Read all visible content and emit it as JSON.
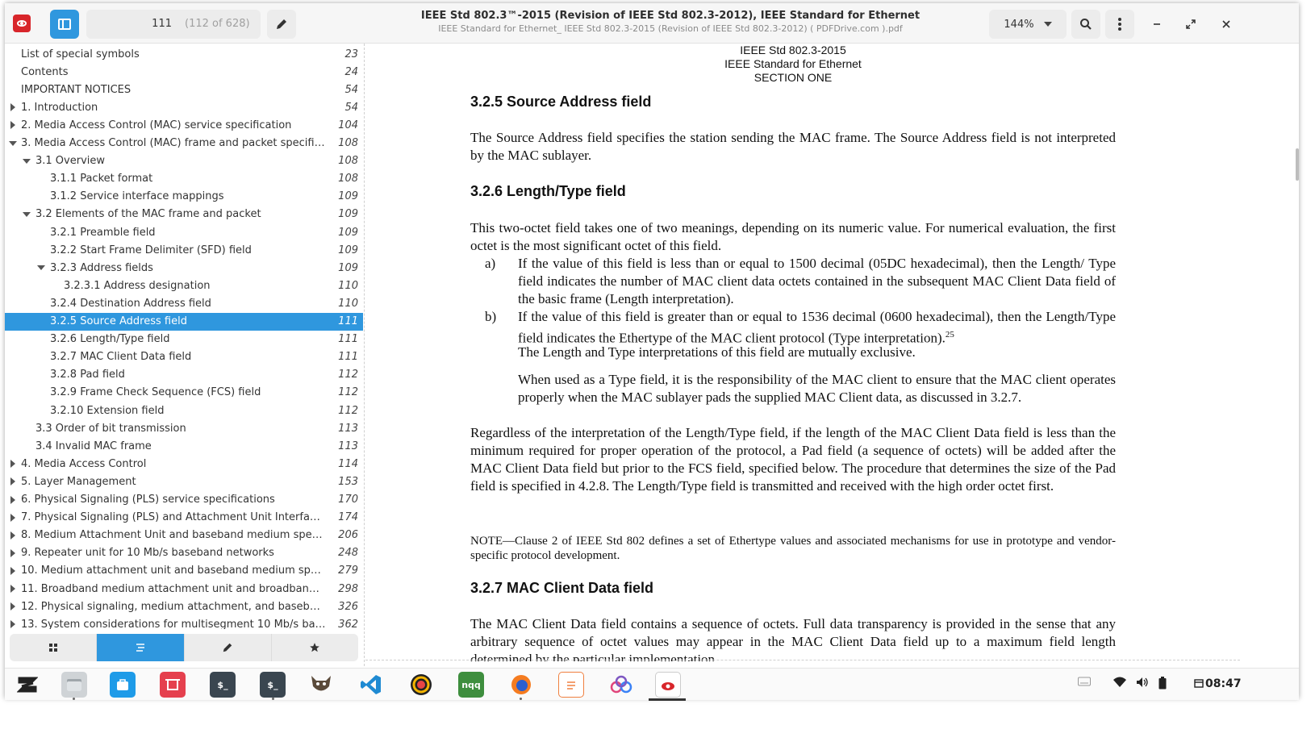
{
  "header": {
    "page_current": "111",
    "page_total": "(112 of 628)",
    "title": "IEEE Std 802.3™-2015 (Revision of IEEE Std 802.3-2012), IEEE Standard for Ethernet",
    "subtitle": "IEEE Standard for Ethernet_ IEEE Std 802.3-2015 (Revision of IEEE Std 802.3-2012) ( PDFDrive.com ).pdf",
    "zoom": "144%"
  },
  "outline": [
    {
      "label": "List of special symbols",
      "page": "23",
      "level": 0,
      "arrow": "none"
    },
    {
      "label": "Contents",
      "page": "24",
      "level": 0,
      "arrow": "none"
    },
    {
      "label": "IMPORTANT NOTICES",
      "page": "54",
      "level": 0,
      "arrow": "none"
    },
    {
      "label": "1. Introduction",
      "page": "54",
      "level": 0,
      "arrow": "right"
    },
    {
      "label": "2. Media Access Control (MAC) service specification",
      "page": "104",
      "level": 0,
      "arrow": "right"
    },
    {
      "label": "3. Media Access Control (MAC) frame and packet specific...",
      "page": "108",
      "level": 0,
      "arrow": "down"
    },
    {
      "label": "3.1 Overview",
      "page": "108",
      "level": 1,
      "arrow": "down"
    },
    {
      "label": "3.1.1 Packet format",
      "page": "108",
      "level": 2,
      "arrow": "none"
    },
    {
      "label": "3.1.2 Service interface mappings",
      "page": "109",
      "level": 2,
      "arrow": "none"
    },
    {
      "label": "3.2 Elements of the MAC frame and packet",
      "page": "109",
      "level": 1,
      "arrow": "down"
    },
    {
      "label": "3.2.1 Preamble field",
      "page": "109",
      "level": 2,
      "arrow": "none"
    },
    {
      "label": "3.2.2 Start Frame Delimiter (SFD) field",
      "page": "109",
      "level": 2,
      "arrow": "none"
    },
    {
      "label": "3.2.3 Address fields",
      "page": "109",
      "level": 2,
      "arrow": "down"
    },
    {
      "label": "3.2.3.1 Address designation",
      "page": "110",
      "level": 3,
      "arrow": "none"
    },
    {
      "label": "3.2.4 Destination Address field",
      "page": "110",
      "level": 2,
      "arrow": "none"
    },
    {
      "label": "3.2.5 Source Address field",
      "page": "111",
      "level": 2,
      "arrow": "none",
      "selected": true
    },
    {
      "label": "3.2.6 Length/Type field",
      "page": "111",
      "level": 2,
      "arrow": "none"
    },
    {
      "label": "3.2.7 MAC Client Data field",
      "page": "111",
      "level": 2,
      "arrow": "none"
    },
    {
      "label": "3.2.8 Pad field",
      "page": "112",
      "level": 2,
      "arrow": "none"
    },
    {
      "label": "3.2.9 Frame Check Sequence (FCS) field",
      "page": "112",
      "level": 2,
      "arrow": "none"
    },
    {
      "label": "3.2.10 Extension field",
      "page": "112",
      "level": 2,
      "arrow": "none"
    },
    {
      "label": "3.3 Order of bit transmission",
      "page": "113",
      "level": 1,
      "arrow": "none"
    },
    {
      "label": "3.4 Invalid MAC frame",
      "page": "113",
      "level": 1,
      "arrow": "none"
    },
    {
      "label": "4. Media Access Control",
      "page": "114",
      "level": 0,
      "arrow": "right"
    },
    {
      "label": "5. Layer Management",
      "page": "153",
      "level": 0,
      "arrow": "right"
    },
    {
      "label": "6. Physical Signaling (PLS) service specifications",
      "page": "170",
      "level": 0,
      "arrow": "right"
    },
    {
      "label": "7. Physical Signaling (PLS) and Attachment Unit Interface (...",
      "page": "174",
      "level": 0,
      "arrow": "right"
    },
    {
      "label": "8. Medium Attachment Unit and baseband medium specifi...",
      "page": "206",
      "level": 0,
      "arrow": "right"
    },
    {
      "label": "9. Repeater unit for 10 Mb/s baseband networks",
      "page": "248",
      "level": 0,
      "arrow": "right"
    },
    {
      "label": "10. Medium attachment unit and baseband medium specifi...",
      "page": "279",
      "level": 0,
      "arrow": "right"
    },
    {
      "label": "11. Broadband medium attachment unit and broadband me...",
      "page": "298",
      "level": 0,
      "arrow": "right"
    },
    {
      "label": "12. Physical signaling, medium attachment, and baseband ...",
      "page": "326",
      "level": 0,
      "arrow": "right"
    },
    {
      "label": "13. System considerations for multisegment 10 Mb/s base...",
      "page": "362",
      "level": 0,
      "arrow": "right"
    }
  ],
  "sidebar_tabs": [
    "thumbnails",
    "outline",
    "annotations",
    "bookmarks"
  ],
  "document": {
    "page_header": [
      "IEEE Std 802.3-2015",
      "IEEE Standard for Ethernet",
      "SECTION ONE"
    ],
    "h325": "3.2.5 Source Address field",
    "p325": "The Source Address field specifies the station sending the MAC frame. The Source Address field is not interpreted by the MAC sublayer.",
    "h326": "3.2.6 Length/Type field",
    "p326": "This two-octet field takes one of two meanings, depending on its numeric value. For numerical evaluation, the first octet is the most significant octet of this field.",
    "item_a_mark": "a)",
    "item_a": "If the value of this field is less than or equal to 1500 decimal (05DC hexadecimal), then the Length/ Type field indicates the number of MAC client data octets contained in the subsequent MAC Client Data field of the basic frame (Length interpretation).",
    "item_b_mark": "b)",
    "item_b": "If the value of this field is greater than or equal to 1536 decimal (0600 hexadecimal), then the Length/Type field indicates the Ethertype of the MAC client protocol (Type interpretation).",
    "item_b_sup": "25",
    "item_b_cont": "The Length and Type interpretations of this field are mutually exclusive.",
    "item_b_para2": "When used as a Type field, it is the responsibility of the MAC client to ensure that the MAC client operates properly when the MAC sublayer pads the supplied MAC Client data, as discussed in 3.2.7.",
    "p_regardless": "Regardless of the interpretation of the Length/Type field, if the length of the MAC Client Data field is less than the minimum required for proper operation of the protocol, a Pad field (a sequence of octets) will be added after the MAC Client Data field but prior to the FCS field, specified below. The procedure that determines the size of the Pad field is specified in 4.2.8. The Length/Type field is transmitted and received with the high order octet first.",
    "note": "NOTE—Clause 2 of IEEE Std 802 defines a set of Ethertype values and associated mechanisms for use in prototype and vendor-specific protocol development.",
    "h327": "3.2.7 MAC Client Data field",
    "p327": "The MAC Client Data field contains a sequence of octets. Full data transparency is provided in the sense that any arbitrary sequence of octet values may appear in the MAC Client Data field up to a maximum field length determined by the particular implementation."
  },
  "taskbar": {
    "apps": [
      "zorin-menu-icon",
      "files-icon",
      "software-store-icon",
      "screenshot-tool-icon",
      "terminal-icon",
      "terminal-2-icon",
      "gimp-icon",
      "vscode-icon",
      "color-picker-icon",
      "notes-app-icon",
      "firefox-icon",
      "text-editor-icon",
      "connections-icon",
      "document-viewer-icon"
    ],
    "clock": "08:47"
  },
  "colors": {
    "accent": "#2f97de",
    "app_red": "#d8262b"
  }
}
